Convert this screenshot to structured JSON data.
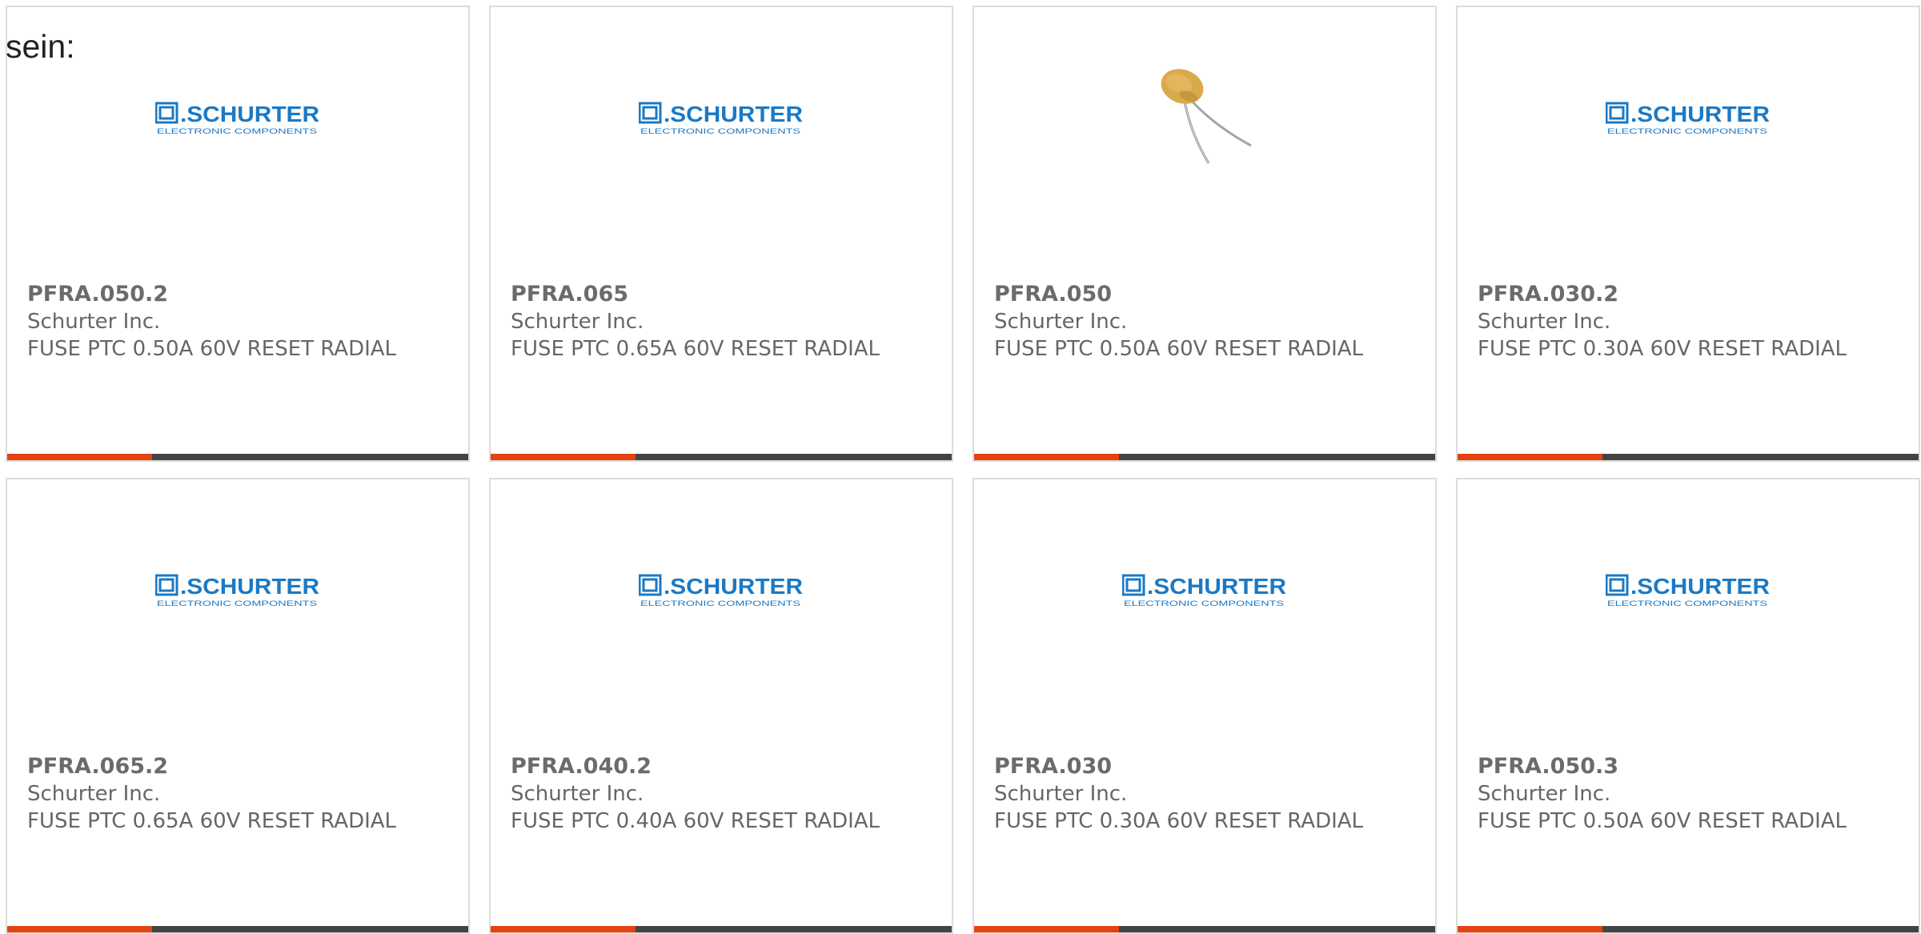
{
  "intro": {
    "text": "sein:"
  },
  "colors": {
    "accent": "#e5420f",
    "bar": "#444444",
    "logo_blue": "#1b79c5",
    "text_gray": "#666666"
  },
  "products": [
    {
      "part_number": "PFRA.050.2",
      "manufacturer": "Schurter Inc.",
      "description": "FUSE PTC 0.50A 60V RESET RADIAL",
      "image": "schurter-logo"
    },
    {
      "part_number": "PFRA.065",
      "manufacturer": "Schurter Inc.",
      "description": "FUSE PTC 0.65A 60V RESET RADIAL",
      "image": "schurter-logo"
    },
    {
      "part_number": "PFRA.050",
      "manufacturer": "Schurter Inc.",
      "description": "FUSE PTC 0.50A 60V RESET RADIAL",
      "image": "radial-ptc-fuse-photo"
    },
    {
      "part_number": "PFRA.030.2",
      "manufacturer": "Schurter Inc.",
      "description": "FUSE PTC 0.30A 60V RESET RADIAL",
      "image": "schurter-logo"
    },
    {
      "part_number": "PFRA.065.2",
      "manufacturer": "Schurter Inc.",
      "description": "FUSE PTC 0.65A 60V RESET RADIAL",
      "image": "schurter-logo"
    },
    {
      "part_number": "PFRA.040.2",
      "manufacturer": "Schurter Inc.",
      "description": "FUSE PTC 0.40A 60V RESET RADIAL",
      "image": "schurter-logo"
    },
    {
      "part_number": "PFRA.030",
      "manufacturer": "Schurter Inc.",
      "description": "FUSE PTC 0.30A 60V RESET RADIAL",
      "image": "schurter-logo"
    },
    {
      "part_number": "PFRA.050.3",
      "manufacturer": "Schurter Inc.",
      "description": "FUSE PTC 0.50A 60V RESET RADIAL",
      "image": "schurter-logo"
    }
  ]
}
